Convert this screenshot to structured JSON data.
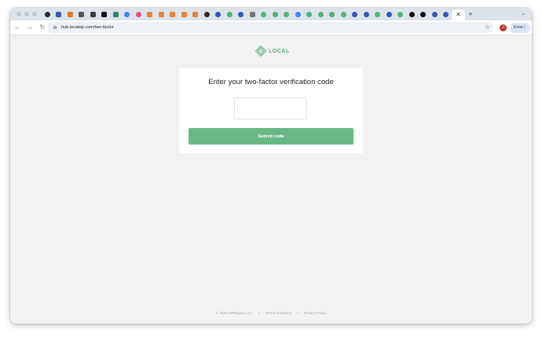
{
  "browser": {
    "tabs": [
      {
        "icon": "github-icon",
        "color": "#2b2b2b",
        "round": true
      },
      {
        "icon": "blue-square-icon",
        "color": "#3a5fa0",
        "round": false
      },
      {
        "icon": "orange-grid-icon",
        "color": "#d9782f",
        "round": false
      },
      {
        "icon": "dark-grid-icon",
        "color": "#555555",
        "round": false
      },
      {
        "icon": "dark-square-icon",
        "color": "#3c3c3c",
        "round": false
      },
      {
        "icon": "black-square-icon",
        "color": "#111111",
        "round": false
      },
      {
        "icon": "green-square-icon",
        "color": "#2e8b57",
        "round": false
      },
      {
        "icon": "google-icon",
        "color": "#4285f4",
        "round": true
      },
      {
        "icon": "pink-circle-icon",
        "color": "#e2557a",
        "round": true
      },
      {
        "icon": "orange-icon",
        "color": "#e8833a",
        "round": false
      },
      {
        "icon": "orange-icon",
        "color": "#e8833a",
        "round": false
      },
      {
        "icon": "orange-icon",
        "color": "#e8833a",
        "round": false
      },
      {
        "icon": "orange-icon",
        "color": "#e8833a",
        "round": false
      },
      {
        "icon": "orange-icon",
        "color": "#e8833a",
        "round": false
      },
      {
        "icon": "github-icon",
        "color": "#2b2b2b",
        "round": true
      },
      {
        "icon": "wordpress-icon",
        "color": "#3858b6",
        "round": true
      },
      {
        "icon": "local-icon",
        "color": "#52b27b",
        "round": true
      },
      {
        "icon": "wordpress-icon",
        "color": "#3858b6",
        "round": true
      },
      {
        "icon": "dots-icon",
        "color": "#777777",
        "round": false
      },
      {
        "icon": "local-icon",
        "color": "#52b27b",
        "round": true
      },
      {
        "icon": "local-icon",
        "color": "#52b27b",
        "round": true
      },
      {
        "icon": "local-icon",
        "color": "#52b27b",
        "round": true
      },
      {
        "icon": "google-icon",
        "color": "#4285f4",
        "round": true
      },
      {
        "icon": "local-icon",
        "color": "#52b27b",
        "round": true
      },
      {
        "icon": "local-icon",
        "color": "#52b27b",
        "round": true
      },
      {
        "icon": "local-icon",
        "color": "#52b27b",
        "round": true
      },
      {
        "icon": "local-icon",
        "color": "#52b27b",
        "round": true
      },
      {
        "icon": "wordpress-icon",
        "color": "#3858b6",
        "round": true
      },
      {
        "icon": "wordpress-icon",
        "color": "#3858b6",
        "round": true
      },
      {
        "icon": "local-icon",
        "color": "#52b27b",
        "round": true
      },
      {
        "icon": "wordpress-icon",
        "color": "#3858b6",
        "round": true
      },
      {
        "icon": "local-icon",
        "color": "#52b27b",
        "round": true
      },
      {
        "icon": "black-circle-icon",
        "color": "#111111",
        "round": true
      },
      {
        "icon": "black-circle-icon",
        "color": "#111111",
        "round": true
      },
      {
        "icon": "wordpress-icon",
        "color": "#3858b6",
        "round": true
      },
      {
        "icon": "wordpress-icon",
        "color": "#3858b6",
        "round": true
      }
    ],
    "active_tab_close": "✕",
    "new_tab": "+",
    "url": "hub.localwp.com/two-factor",
    "profile_initial": "J",
    "error_label": "Error"
  },
  "brand": {
    "name": "LOCAL",
    "accent": "#52b27b"
  },
  "form": {
    "title": "Enter your two-factor verification code",
    "code_value": "",
    "submit_label": "Submit code",
    "button_color": "#69b985"
  },
  "footer": {
    "copyright": "© 2024 WPEngine, Inc.",
    "terms": "Terms of Service",
    "privacy": "Privacy Policy",
    "separator": "•"
  }
}
